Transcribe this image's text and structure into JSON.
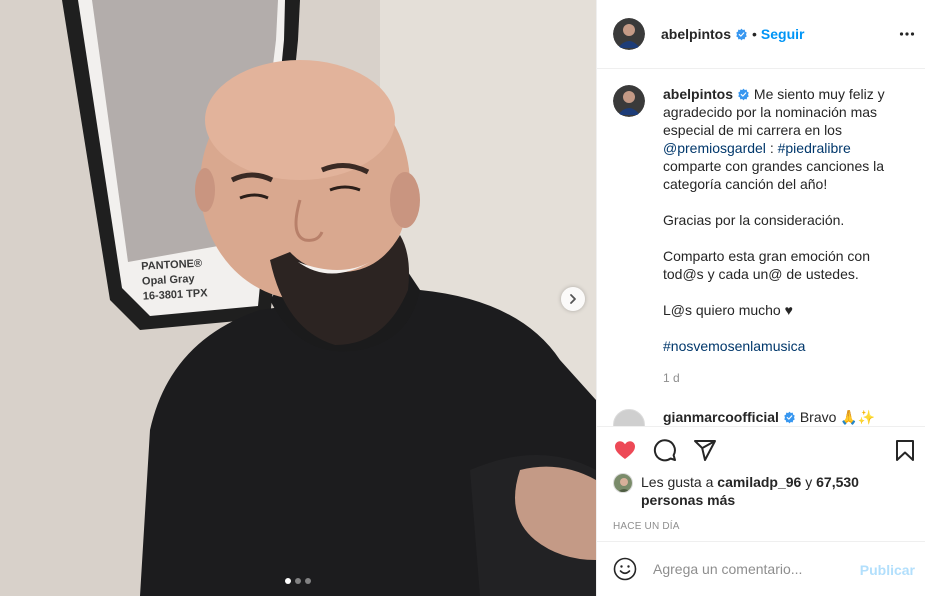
{
  "post": {
    "username": "abelpintos",
    "follow_label": "Seguir",
    "separator": "•",
    "caption": {
      "line1": "Me siento muy feliz y agradecido por la nominación mas especial de mi carrera en los",
      "mention": "@premiosgardel",
      "colon": ":",
      "hashtag1": "#piedralibre",
      "line2": "comparte con grandes canciones la categoría canción del año!",
      "para2": "Gracias por la consideración.",
      "para3": "Comparto esta gran emoción con tod@s y cada un@ de ustedes.",
      "para4": "L@s quiero mucho ♥",
      "hashtag2": "#nosvemosenlamusica"
    },
    "caption_time": "1 d",
    "comment": {
      "username": "gianmarcoofficial",
      "text": "Bravo 🙏✨"
    },
    "likes": {
      "prefix": "Les gusta a",
      "user": "camiladp_96",
      "middle": "y",
      "count": "67,530 personas más"
    },
    "timestamp": "HACE UN DÍA",
    "add_comment_placeholder": "Agrega un comentario...",
    "publish_label": "Publicar"
  },
  "photo": {
    "poster_lines": [
      "PANTONE®",
      "Opal Gray",
      "16-3801 TPX"
    ],
    "carousel_current": 1,
    "carousel_total": 3
  },
  "colors": {
    "link": "#0095f6",
    "like_red": "#ed4956",
    "publish_disabled": "#b2dffc",
    "muted": "#8e8e8e"
  },
  "icons": [
    "verified-badge-icon",
    "more-options-icon",
    "heart-icon",
    "comment-icon",
    "share-icon",
    "bookmark-icon",
    "emoji-icon",
    "chevron-right-icon"
  ]
}
